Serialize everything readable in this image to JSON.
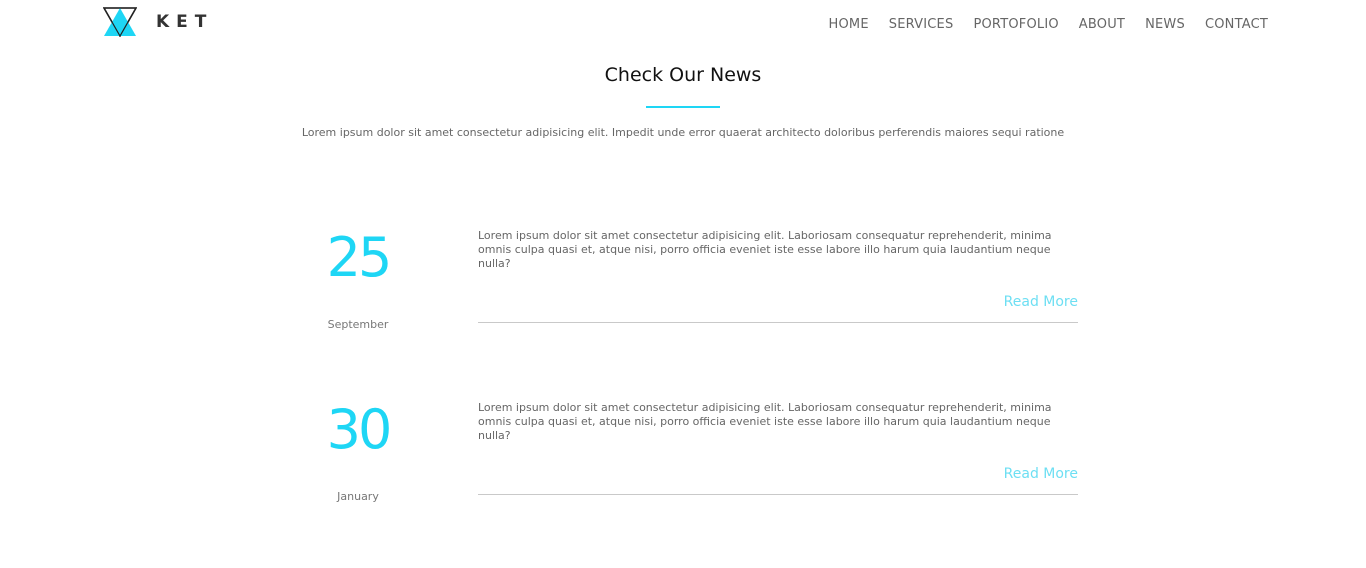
{
  "header": {
    "logo_text": "KET",
    "nav": [
      "HOME",
      "SERVICES",
      "PORTOFOLIO",
      "ABOUT",
      "NEWS",
      "CONTACT"
    ]
  },
  "section": {
    "title": "Check Our News",
    "subtitle": "Lorem ipsum dolor sit amet consectetur adipisicing elit. Impedit unde error quaerat architecto doloribus perferendis maiores sequi ratione"
  },
  "news": [
    {
      "day": "25",
      "month": "September",
      "text": "Lorem ipsum dolor sit amet consectetur adipisicing elit. Laboriosam consequatur reprehenderit, minima omnis culpa quasi et, atque nisi, porro officia eveniet iste esse labore illo harum quia laudantium neque nulla?",
      "read_more": "Read More"
    },
    {
      "day": "30",
      "month": "January",
      "text": "Lorem ipsum dolor sit amet consectetur adipisicing elit. Laboriosam consequatur reprehenderit, minima omnis culpa quasi et, atque nisi, porro officia eveniet iste esse labore illo harum quia laudantium neque nulla?",
      "read_more": "Read More"
    }
  ],
  "colors": {
    "accent": "#1ed6f5",
    "read_more": "#6ddff3",
    "divider": "#c9c9c9"
  },
  "icons": {
    "logo": "triangle-logo-icon"
  }
}
